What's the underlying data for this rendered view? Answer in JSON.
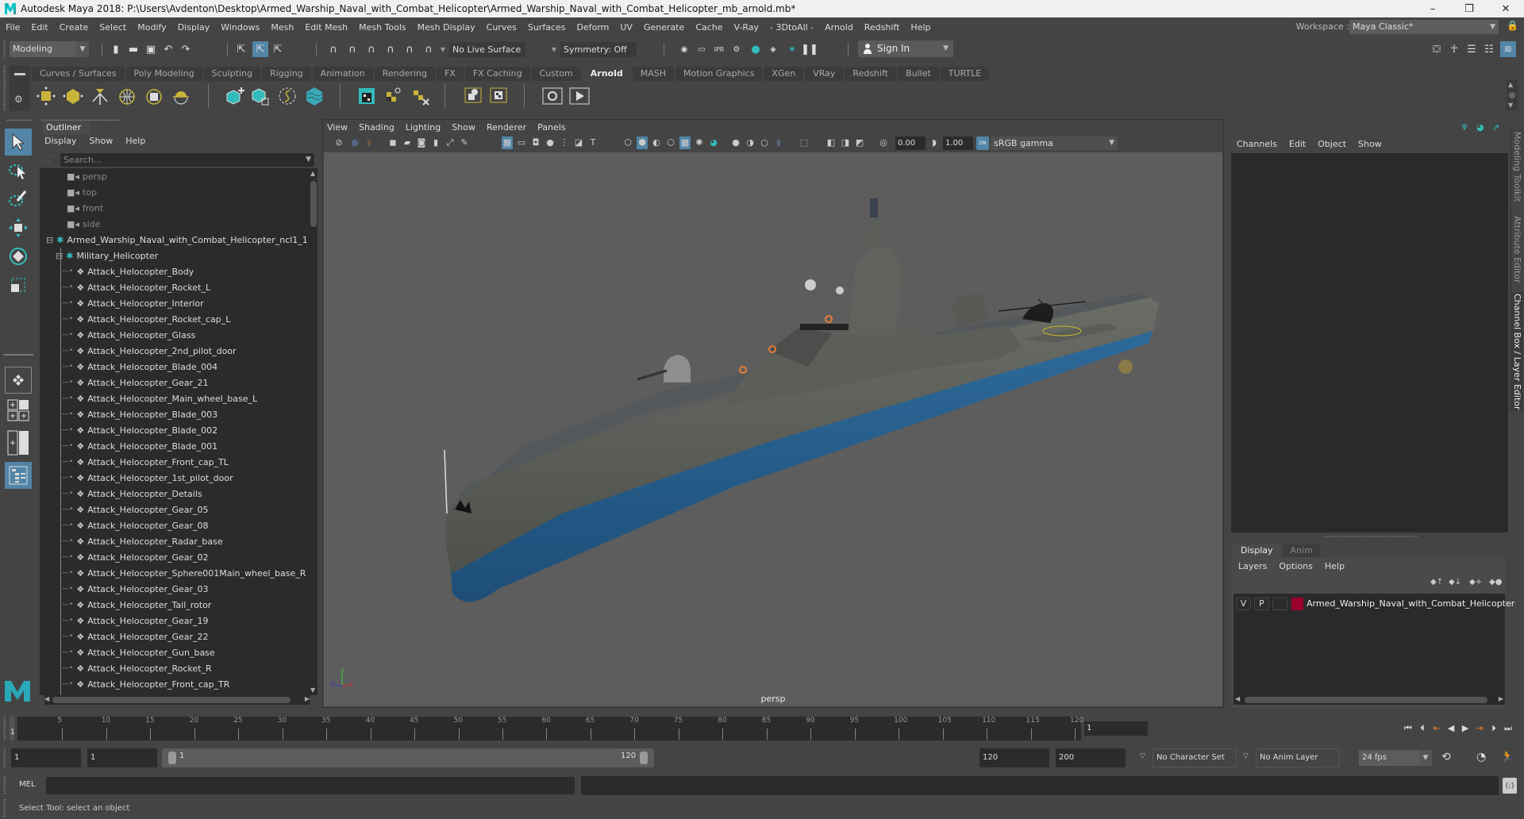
{
  "window": {
    "title": "Autodesk Maya 2018: P:\\Users\\Avdenton\\Desktop\\Armed_Warship_Naval_with_Combat_Helicopter\\Armed_Warship_Naval_with_Combat_Helicopter_mb_arnold.mb*",
    "minimize": "–",
    "maximize": "❐",
    "close": "✕"
  },
  "menubar": {
    "items": [
      "File",
      "Edit",
      "Create",
      "Select",
      "Modify",
      "Display",
      "Windows",
      "Mesh",
      "Edit Mesh",
      "Mesh Tools",
      "Mesh Display",
      "Curves",
      "Surfaces",
      "Deform",
      "UV",
      "Generate",
      "Cache",
      "V-Ray",
      "- 3DtoAll -",
      "Arnold",
      "Redshift",
      "Help"
    ],
    "workspace_label": "Workspace :",
    "workspace_value": "Maya Classic*"
  },
  "statusline": {
    "mode": "Modeling",
    "live_surface": "No Live Surface",
    "symmetry": "Symmetry: Off",
    "sign_in": "Sign In"
  },
  "shelf": {
    "tabs": [
      "Curves / Surfaces",
      "Poly Modeling",
      "Sculpting",
      "Rigging",
      "Animation",
      "Rendering",
      "FX",
      "FX Caching",
      "Custom",
      "Arnold",
      "MASH",
      "Motion Graphics",
      "XGen",
      "VRay",
      "Redshift",
      "Bullet",
      "TURTLE"
    ],
    "active_tab": "Arnold",
    "icons": [
      "area-light-icon",
      "mesh-light-icon",
      "photometric-light-icon",
      "skydome-light-icon",
      "light-portal-icon",
      "physical-sky-icon",
      "standin-create-icon",
      "standin-export-icon",
      "curve-collector-icon",
      "volume-icon",
      "render-view-icon",
      "texture-tx-icon",
      "remove-tx-icon",
      "shader-assign-icon",
      "material-flags-icon",
      "ipr-eye-icon",
      "render-play-icon"
    ]
  },
  "outliner": {
    "tab": "Outliner",
    "menu": [
      "Display",
      "Show",
      "Help"
    ],
    "search_placeholder": "Search...",
    "cameras": [
      "persp",
      "top",
      "front",
      "side"
    ],
    "root": "Armed_Warship_Naval_with_Combat_Helicopter_ncl1_1",
    "group": "Military_Helicopter",
    "children": [
      "Attack_Helocopter_Body",
      "Attack_Helocopter_Rocket_L",
      "Attack_Helocopter_Interior",
      "Attack_Helocopter_Rocket_cap_L",
      "Attack_Helocopter_Glass",
      "Attack_Helocopter_2nd_pilot_door",
      "Attack_Helocopter_Blade_004",
      "Attack_Helocopter_Gear_21",
      "Attack_Helocopter_Main_wheel_base_L",
      "Attack_Helocopter_Blade_003",
      "Attack_Helocopter_Blade_002",
      "Attack_Helocopter_Blade_001",
      "Attack_Helocopter_Front_cap_TL",
      "Attack_Helocopter_1st_pilot_door",
      "Attack_Helocopter_Details",
      "Attack_Helocopter_Gear_05",
      "Attack_Helocopter_Gear_08",
      "Attack_Helocopter_Radar_base",
      "Attack_Helocopter_Gear_02",
      "Attack_Helocopter_Sphere001Main_wheel_base_R",
      "Attack_Helocopter_Gear_03",
      "Attack_Helocopter_Tail_rotor",
      "Attack_Helocopter_Gear_19",
      "Attack_Helocopter_Gear_22",
      "Attack_Helocopter_Gun_base",
      "Attack_Helocopter_Rocket_R",
      "Attack_Helocopter_Front_cap_TR"
    ]
  },
  "viewport": {
    "menu": [
      "View",
      "Shading",
      "Lighting",
      "Show",
      "Renderer",
      "Panels"
    ],
    "exposure": "0.00",
    "gamma": "1.00",
    "color_management": "ON",
    "color_space": "sRGB gamma",
    "camera_label": "persp",
    "axis": {
      "x": "x",
      "y": "y",
      "z": "z"
    }
  },
  "channelbox": {
    "menu": [
      "Channels",
      "Edit",
      "Object",
      "Show"
    ],
    "side_tabs": [
      "Modeling Toolkit",
      "Attribute Editor",
      "Channel Box / Layer Editor"
    ],
    "active_side_tab": "Channel Box / Layer Editor"
  },
  "layer_editor": {
    "tabs": [
      "Display",
      "Anim"
    ],
    "active_tab": "Display",
    "menu": [
      "Layers",
      "Options",
      "Help"
    ],
    "layers": [
      {
        "visible": "V",
        "playback": "P",
        "type": "",
        "color": "#99002b",
        "name": "Armed_Warship_Naval_with_Combat_Helicopter"
      }
    ]
  },
  "timeline": {
    "ticks": [
      5,
      10,
      15,
      20,
      25,
      30,
      35,
      40,
      45,
      50,
      55,
      60,
      65,
      70,
      75,
      80,
      85,
      90,
      95,
      100,
      105,
      110,
      115,
      120
    ],
    "min": 1,
    "max": 120,
    "current_frame": "1",
    "current_frame_field": "1"
  },
  "range": {
    "anim_start": "1",
    "playback_start": "1",
    "slider_start": "1",
    "slider_end": "120",
    "playback_end": "120",
    "anim_end": "200",
    "character_set": "No Character Set",
    "anim_layer": "No Anim Layer",
    "fps": "24 fps"
  },
  "command": {
    "mel_label": "MEL",
    "help_line": "Select Tool: select an object"
  },
  "colors": {
    "accent": "#5285a6",
    "viewport_bg": "#5d5d5d",
    "panel_bg": "#444444",
    "field_bg": "#2b2b2b",
    "layer_color": "#99002b",
    "playhead_orange": "#e07b2a"
  }
}
